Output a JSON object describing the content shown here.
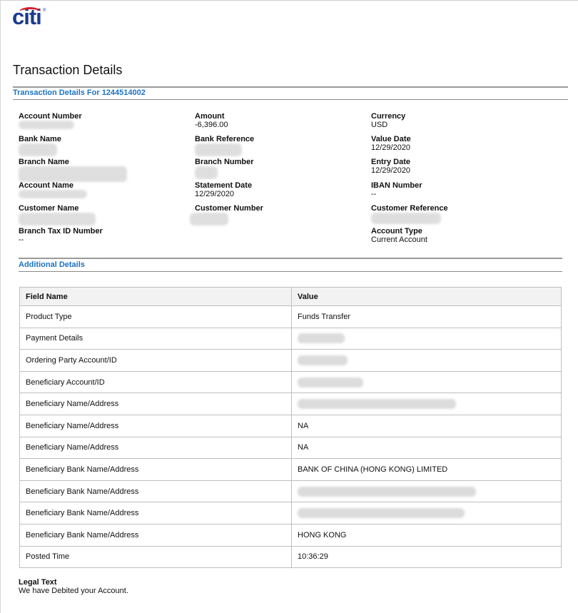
{
  "brand": {
    "name": "citi"
  },
  "page_title": "Transaction Details",
  "section1_title": "Transaction Details For 1244514002",
  "fields": {
    "account_number": {
      "label": "Account Number",
      "value": ""
    },
    "amount": {
      "label": "Amount",
      "value": "-6,396.00"
    },
    "currency": {
      "label": "Currency",
      "value": "USD"
    },
    "bank_name": {
      "label": "Bank Name",
      "value": ""
    },
    "bank_reference": {
      "label": "Bank Reference",
      "value": ""
    },
    "value_date": {
      "label": "Value Date",
      "value": "12/29/2020"
    },
    "branch_name": {
      "label": "Branch Name",
      "value": ""
    },
    "branch_number": {
      "label": "Branch Number",
      "value": ""
    },
    "entry_date": {
      "label": "Entry Date",
      "value": "12/29/2020"
    },
    "account_name": {
      "label": "Account Name",
      "value": ""
    },
    "statement_date": {
      "label": "Statement Date",
      "value": "12/29/2020"
    },
    "iban_number": {
      "label": "IBAN Number",
      "value": "--"
    },
    "customer_name": {
      "label": "Customer Name",
      "value": ""
    },
    "customer_number": {
      "label": "Customer Number",
      "value": ""
    },
    "customer_reference": {
      "label": "Customer Reference",
      "value": ""
    },
    "branch_tax_id": {
      "label": "Branch Tax ID Number",
      "value": "--"
    },
    "account_type": {
      "label": "Account Type",
      "value": "Current Account"
    }
  },
  "section2_title": "Additional Details",
  "table": {
    "headers": [
      "Field Name",
      "Value"
    ],
    "rows": [
      {
        "field": "Product Type",
        "value": "Funds Transfer"
      },
      {
        "field": "Payment Details",
        "value": ""
      },
      {
        "field": "Ordering Party Account/ID",
        "value": ""
      },
      {
        "field": "Beneficiary Account/ID",
        "value": ""
      },
      {
        "field": "Beneficiary Name/Address",
        "value": ""
      },
      {
        "field": "Beneficiary Name/Address",
        "value": "NA"
      },
      {
        "field": "Beneficiary Name/Address",
        "value": "NA"
      },
      {
        "field": "Beneficiary Bank Name/Address",
        "value": "BANK OF CHINA (HONG KONG) LIMITED"
      },
      {
        "field": "Beneficiary Bank Name/Address",
        "value": ""
      },
      {
        "field": "Beneficiary Bank Name/Address",
        "value": ""
      },
      {
        "field": "Beneficiary Bank Name/Address",
        "value": "HONG KONG"
      },
      {
        "field": "Posted Time",
        "value": "10:36:29"
      }
    ]
  },
  "legal": {
    "title": "Legal Text",
    "text": "We have Debited your Account."
  },
  "colors": {
    "brand_blue": "#1a3b8f",
    "brand_red": "#d6202b",
    "section_blue": "#1b73c2"
  }
}
